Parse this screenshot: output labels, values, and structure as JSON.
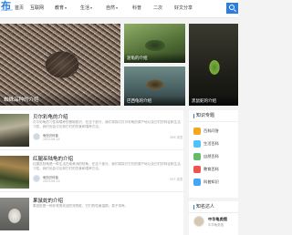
{
  "header": {
    "logo_text": "布",
    "logo_sub": "jhlp.com",
    "nav": [
      {
        "label": "首页",
        "dropdown": false,
        "active": false
      },
      {
        "label": "互联网",
        "dropdown": false,
        "active": false
      },
      {
        "label": "教育",
        "dropdown": true,
        "active": false
      },
      {
        "label": "生活",
        "dropdown": true,
        "active": false
      },
      {
        "label": "自然",
        "dropdown": true,
        "active": false
      },
      {
        "label": "科普",
        "dropdown": false,
        "active": false
      },
      {
        "label": "二次",
        "dropdown": false,
        "active": false
      },
      {
        "label": "好文分享",
        "dropdown": false,
        "active": false
      }
    ],
    "caret": "▾"
  },
  "slider": {
    "title": "蜘蛛品种的介绍",
    "dot_count": 5
  },
  "cards": [
    {
      "title": "泥龟的介绍"
    },
    {
      "title": "巴西龟的介绍"
    },
    {
      "title": "黑鼠蛇的介绍"
    }
  ],
  "articles": [
    {
      "title": "贝尔彩龟的介绍",
      "excerpt": "贝尔彩龟的习性和喂养的基础知识，在这个部分，我们将探讨贝尔彩龟的原产地以及它们的特征和生活习性，我们也会讨论到它们的饮食和喂养方法。",
      "author": "龟知识科普",
      "time": "2023-06-14",
      "views": "356 浏览"
    },
    {
      "title": "红腿巫陆龟的介绍",
      "excerpt": "红腿巫陆龟是一种生活在南美洲的陆龟，在这个部分，我们将探讨它们的原产地以及它们的特征和生活习性，我们也会讨论到它们的饮食和喂养方法。",
      "author": "龟知识科普",
      "time": "2023-06-14",
      "views": "297 浏览"
    },
    {
      "title": "果鼠蛇的介绍",
      "excerpt": "果鼠蛇是一种非常受欢迎的宠物蛇，它们的性格温顺，易于饲养。",
      "author": "",
      "time": "",
      "views": ""
    }
  ],
  "sidebar": {
    "topics_title": "知识专题",
    "topics": [
      {
        "label": "百科问答",
        "color": "#f5a623"
      },
      {
        "label": "生活百科",
        "color": "#4fc3f7"
      },
      {
        "label": "自然百科",
        "color": "#66bb6a"
      },
      {
        "label": "教育百科",
        "color": "#ef5350"
      },
      {
        "label": "科普知识",
        "color": "#42a5f5"
      }
    ],
    "authors_title": "知名达人",
    "author": {
      "name": "中华龟类馆",
      "desc": "中华龟类馆"
    }
  }
}
